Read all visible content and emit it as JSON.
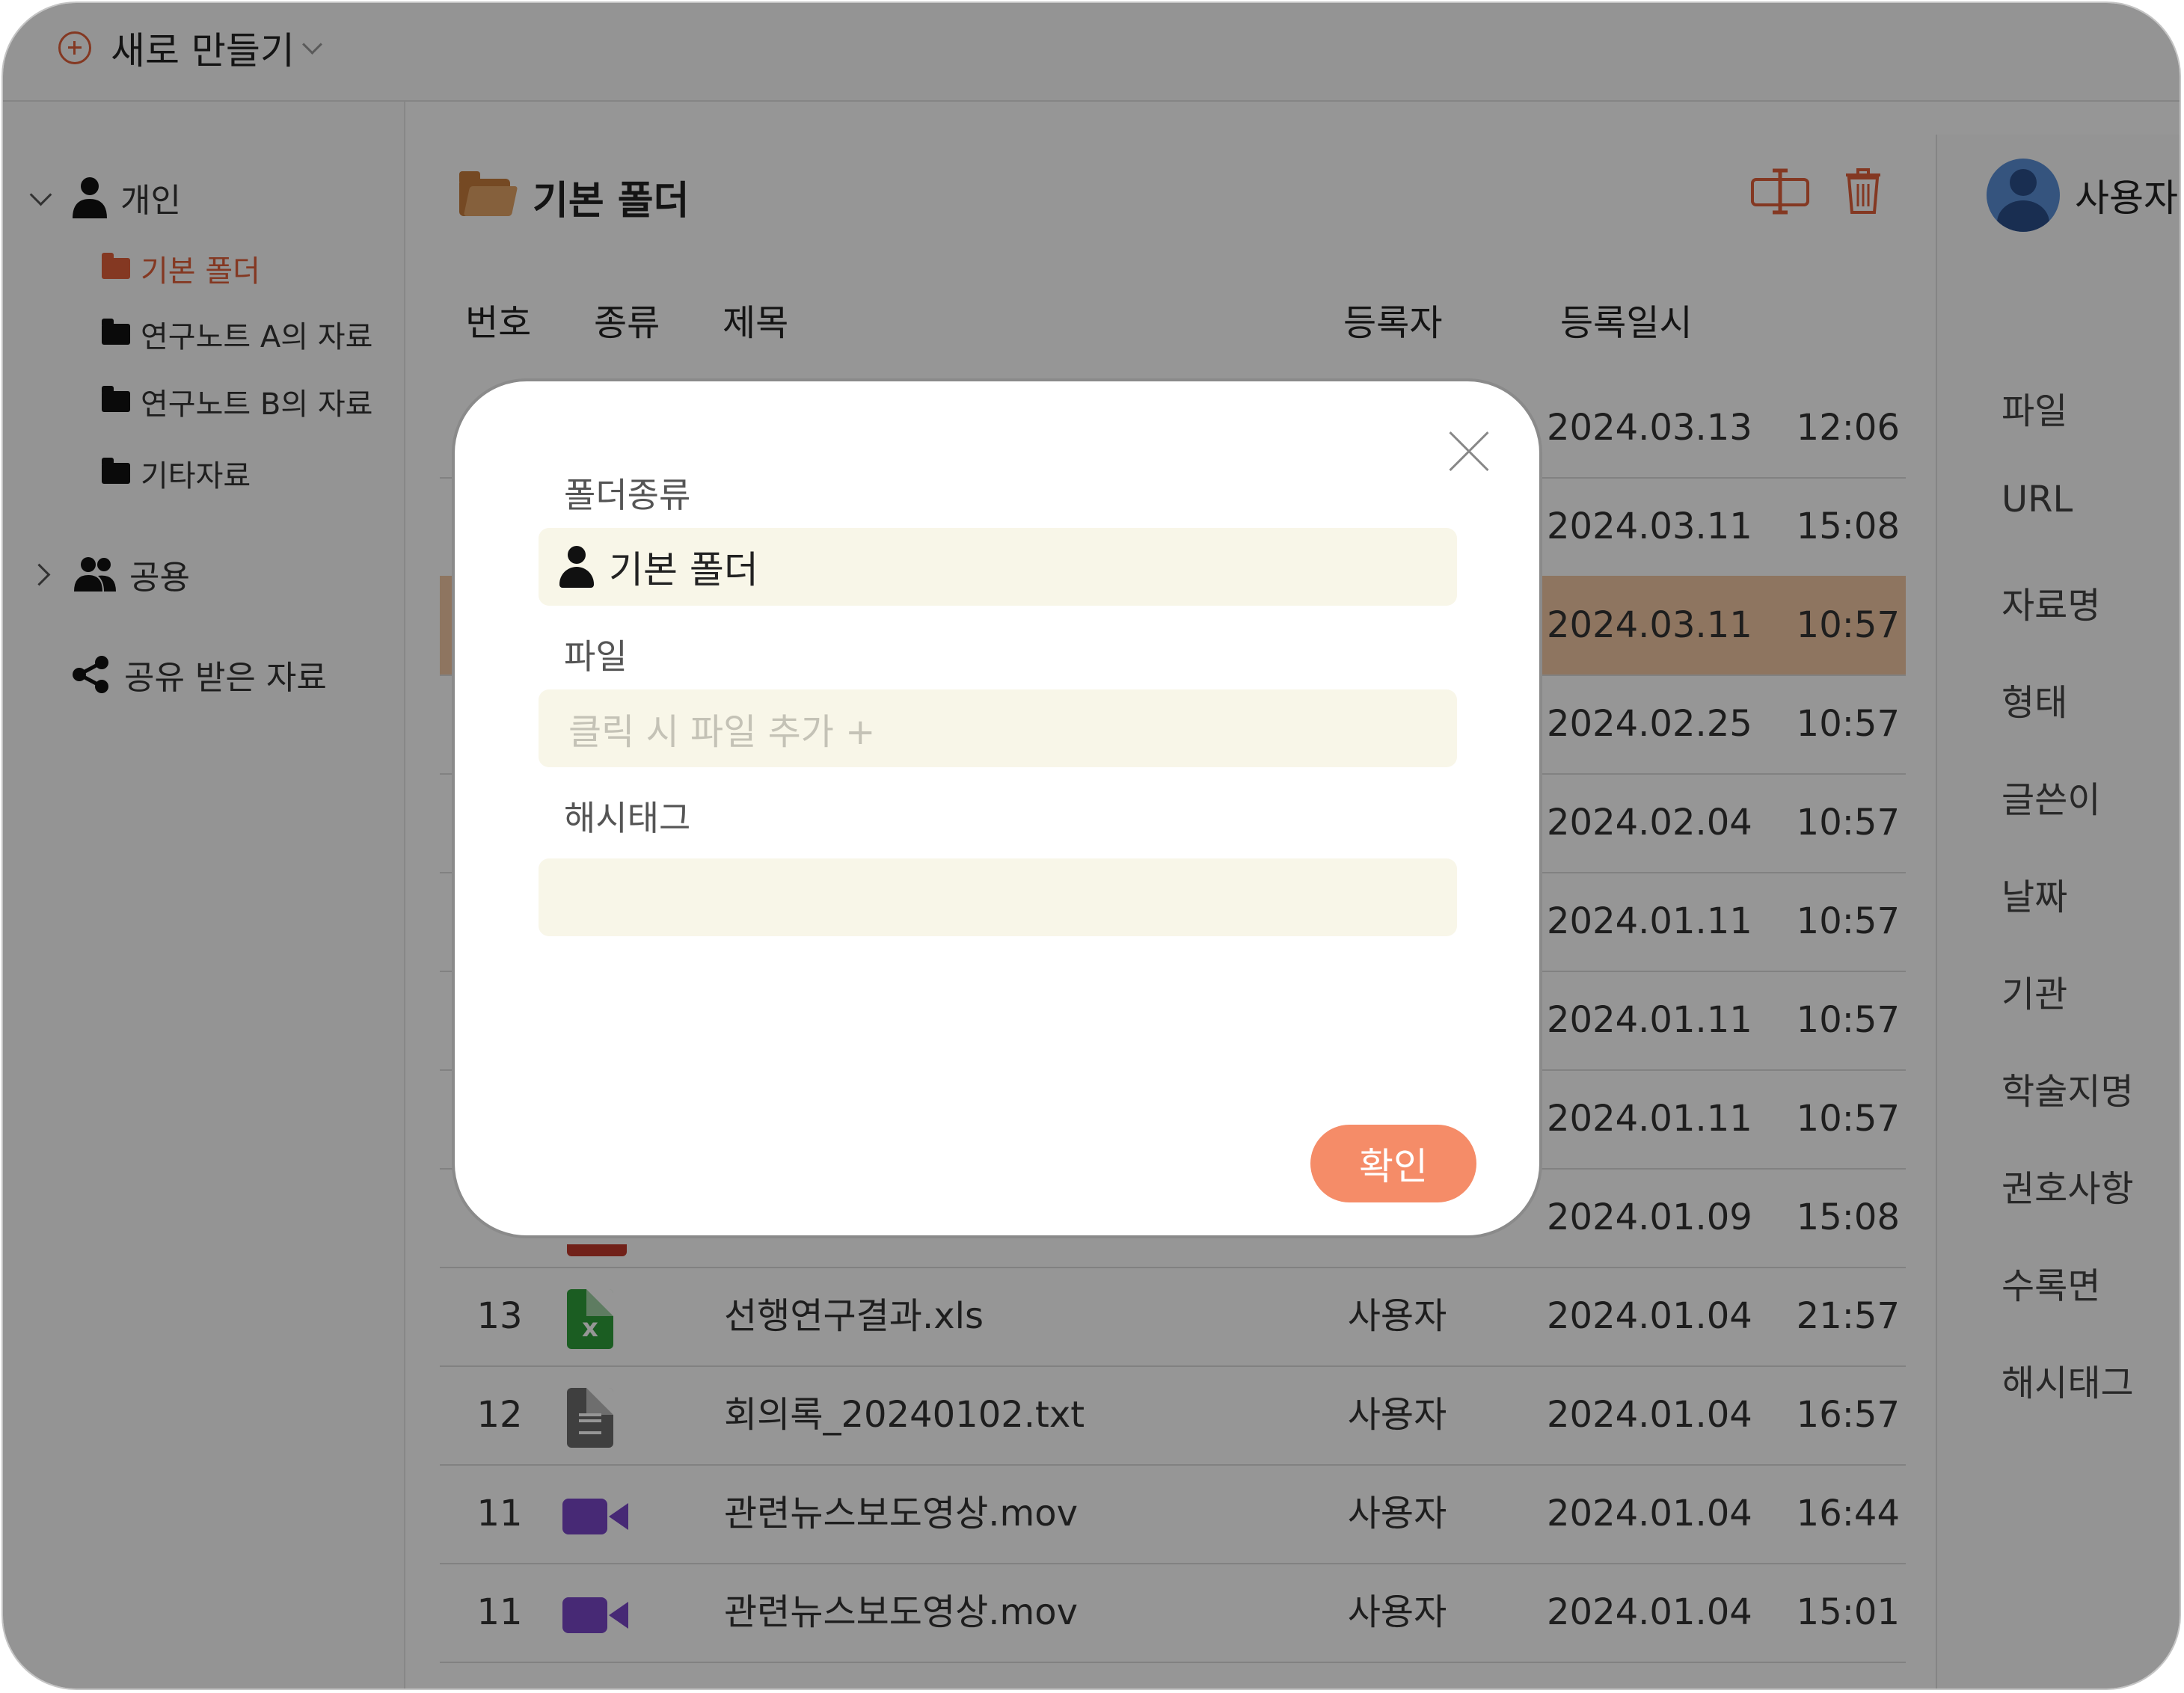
{
  "header": {
    "new_label": "새로 만들기"
  },
  "sidebar": {
    "personal": "개인",
    "folders": [
      "기본 폴더",
      "연구노트 A의 자료",
      "연구노트 B의 자료",
      "기타자료"
    ],
    "public": "공용",
    "shared": "공유 받은 자료"
  },
  "main": {
    "folder_title": "기본 폴더",
    "columns": {
      "num": "번호",
      "type": "종류",
      "title": "제목",
      "user": "등록자",
      "date": "등록일시"
    }
  },
  "rows": [
    {
      "num": "",
      "title": "",
      "user": "",
      "date": "2024.03.13",
      "time": "12:06",
      "icon": ""
    },
    {
      "num": "",
      "title": "",
      "user": "",
      "date": "2024.03.11",
      "time": "15:08",
      "icon": ""
    },
    {
      "num": "",
      "title": "",
      "user": "",
      "date": "2024.03.11",
      "time": "10:57",
      "icon": "",
      "highlight": true
    },
    {
      "num": "",
      "title": "",
      "user": "",
      "date": "2024.02.25",
      "time": "10:57",
      "icon": ""
    },
    {
      "num": "",
      "title": "",
      "user": "",
      "date": "2024.02.04",
      "time": "10:57",
      "icon": ""
    },
    {
      "num": "",
      "title": "",
      "user": "",
      "date": "2024.01.11",
      "time": "10:57",
      "icon": ""
    },
    {
      "num": "",
      "title": "",
      "user": "",
      "date": "2024.01.11",
      "time": "10:57",
      "icon": ""
    },
    {
      "num": "",
      "title": "",
      "user": "",
      "date": "2024.01.11",
      "time": "10:57",
      "icon": ""
    },
    {
      "num": "",
      "title": "",
      "user": "",
      "date": "2024.01.09",
      "time": "15:08",
      "icon": "pdf-icon"
    },
    {
      "num": "13",
      "title": "선행연구결과.xls",
      "user": "사용자",
      "date": "2024.01.04",
      "time": "21:57",
      "icon": "excel-file-icon"
    },
    {
      "num": "12",
      "title": "회의록_20240102.txt",
      "user": "사용자",
      "date": "2024.01.04",
      "time": "16:57",
      "icon": "text-file-icon"
    },
    {
      "num": "11",
      "title": "관련뉴스보도영상.mov",
      "user": "사용자",
      "date": "2024.01.04",
      "time": "16:44",
      "icon": "video-file-icon"
    },
    {
      "num": "11",
      "title": "관련뉴스보도영상.mov",
      "user": "사용자",
      "date": "2024.01.04",
      "time": "15:01",
      "icon": "video-file-icon"
    }
  ],
  "right_panel": {
    "user": "사용자",
    "items": [
      "파일",
      "URL",
      "자료명",
      "형태",
      "글쓴이",
      "날짜",
      "기관",
      "학술지명",
      "권호사항",
      "수록면",
      "해시태그"
    ]
  },
  "modal": {
    "folder_type_label": "폴더종류",
    "folder_type_value": "기본 폴더",
    "file_label": "파일",
    "file_placeholder": "클릭 시 파일 추가 +",
    "hashtag_label": "해시태그",
    "hashtag_value": "",
    "confirm": "확인"
  },
  "colors": {
    "accent": "#e0603a",
    "confirm": "#f58c68",
    "field_bg": "#f8f6e8",
    "highlight_row": "#f1c8a4"
  }
}
